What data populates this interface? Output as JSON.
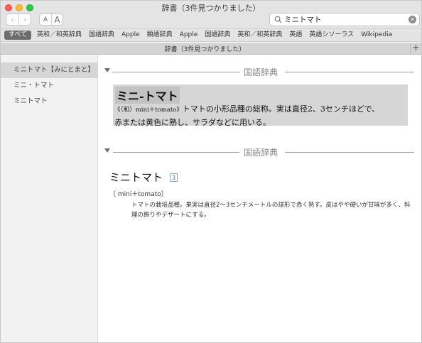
{
  "window": {
    "title": "辞書（3件見つかりました）"
  },
  "toolbar": {
    "back": "‹",
    "forward": "›",
    "font_small": "A",
    "font_large": "A",
    "search_value": "ミニトマト",
    "clear": "✕"
  },
  "sources": [
    "すべて",
    "英和／和英辞典",
    "国語辞典",
    "Apple",
    "類語辞典",
    "Apple",
    "国語辞典",
    "英和／和英辞典",
    "英語",
    "英語シソーラス",
    "Wikipedia"
  ],
  "tab": {
    "title": "辞書（3件見つかりました）",
    "add": "+"
  },
  "sidebar": {
    "items": [
      "ミニトマト【みにとまと】",
      "ミニ・トマト",
      "ミニトマト"
    ]
  },
  "sections": [
    {
      "title": "国語辞典",
      "headword": "ミニ-トマト",
      "origin": "《（和）mini＋tomato》",
      "definition_line1": "トマトの小形品種の総称。実は直径2、3センチほどで、",
      "definition_line2": "赤または黄色に熟し、サラダなどに用いる。"
    },
    {
      "title": "国語辞典",
      "headword": "ミニトマト",
      "badge": "3",
      "origin": "〔 mini＋tomato〕",
      "definition": "トマトの栽培品種。果実は直径2〜3センチメートルの球形で赤く熟す。皮はやや硬いが甘味が多く、料理の飾りやデザートにする。"
    }
  ]
}
